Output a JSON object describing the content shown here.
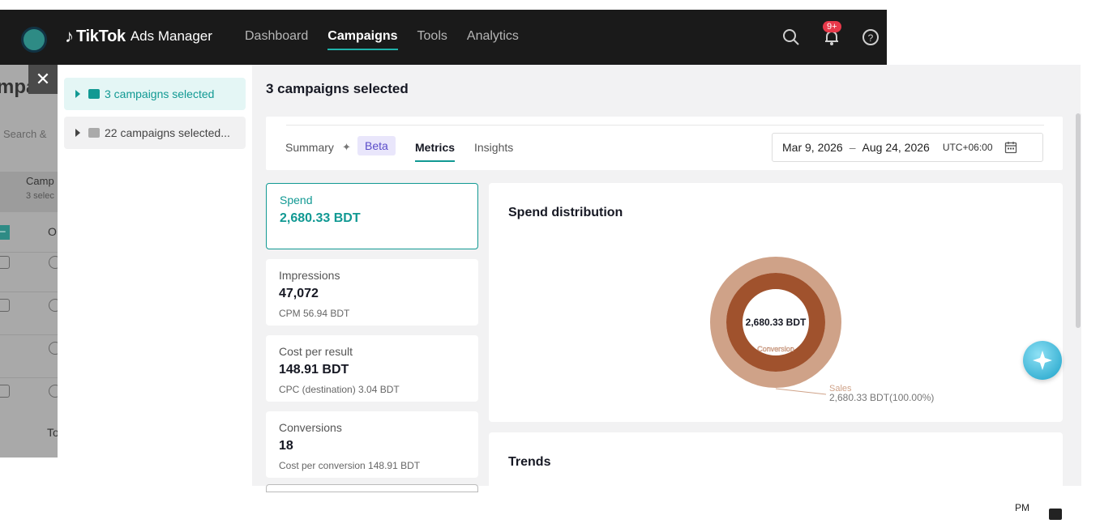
{
  "nav": {
    "brand_name": "TikTok",
    "brand_sub": "Ads Manager",
    "items": [
      {
        "label": "Dashboard",
        "active": false
      },
      {
        "label": "Campaigns",
        "active": true
      },
      {
        "label": "Tools",
        "active": false
      },
      {
        "label": "Analytics",
        "active": false
      }
    ],
    "notification_badge": "9+"
  },
  "background_page": {
    "title_fragment": "mpa",
    "search_fragment": "Search &",
    "campaign_fragment": "Camp",
    "campaign_sub_fragment": "3 selec",
    "column_fragment": "O",
    "total_fragment": "To"
  },
  "selector": {
    "items": [
      {
        "label": "3 campaigns selected",
        "active": true
      },
      {
        "label": "22 campaigns selected...",
        "active": false
      }
    ]
  },
  "main": {
    "title": "3 campaigns selected",
    "tabs": [
      {
        "label": "Summary",
        "active": false
      },
      {
        "label": "Metrics",
        "active": true
      },
      {
        "label": "Insights",
        "active": false
      }
    ],
    "beta_label": "Beta",
    "date_range": {
      "start": "Mar 9, 2026",
      "separator": "–",
      "end": "Aug 24, 2026",
      "timezone": "UTC+06:00"
    },
    "metrics": [
      {
        "label": "Spend",
        "value": "2,680.33 BDT",
        "sub": "",
        "selected": true
      },
      {
        "label": "Impressions",
        "value": "47,072",
        "sub": "CPM 56.94 BDT",
        "selected": false
      },
      {
        "label": "Cost per result",
        "value": "148.91 BDT",
        "sub": "CPC (destination) 3.04 BDT",
        "selected": false
      },
      {
        "label": "Conversions",
        "value": "18",
        "sub": "Cost per conversion 148.91 BDT",
        "selected": false
      }
    ],
    "distribution_title": "Spend distribution",
    "trends_title": "Trends"
  },
  "chart_data": {
    "type": "pie",
    "center_label": "2,680.33 BDT",
    "inner_ring_label": "Conversion",
    "rings": [
      {
        "name": "Sales",
        "values": [
          2680.33
        ],
        "percent": [
          100.0
        ],
        "color": "#cfa288"
      },
      {
        "name": "Conversion",
        "values": [
          2680.33
        ],
        "percent": [
          100.0
        ],
        "color": "#a0522d"
      }
    ],
    "callout": {
      "name": "Sales",
      "text": "2,680.33 BDT(100.00%)"
    }
  },
  "footer": {
    "time_fragment": "PM"
  },
  "colors": {
    "accent": "#119993",
    "nav_bg": "#1a1a1a",
    "badge": "#e8394a",
    "outer_ring": "#cfa288",
    "inner_ring": "#a0522d"
  }
}
